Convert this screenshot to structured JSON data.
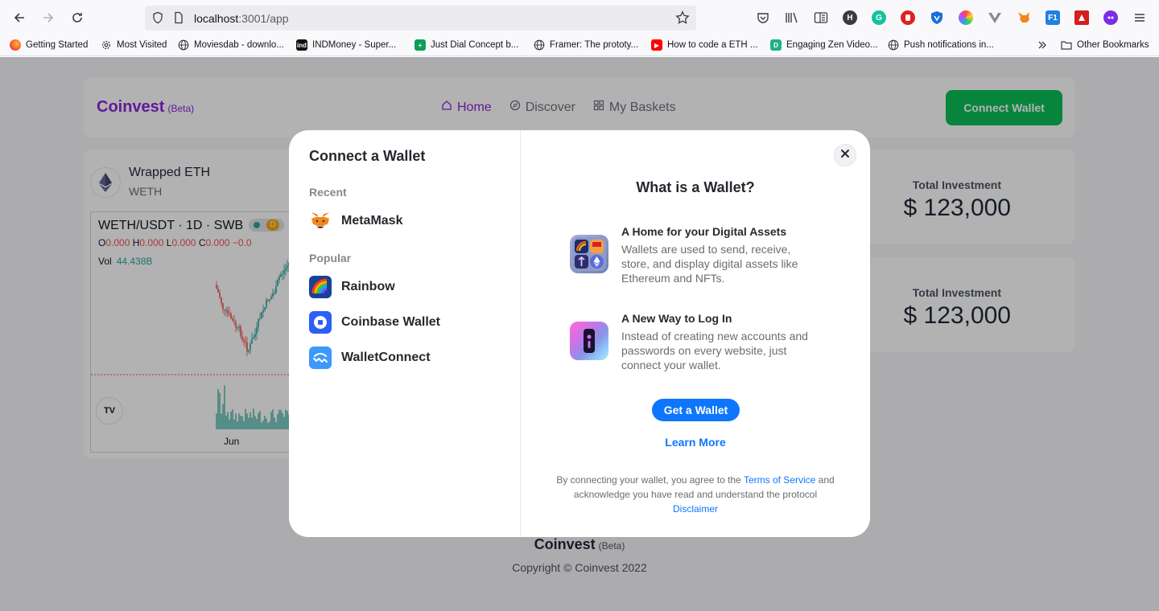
{
  "browser": {
    "url_host": "localhost",
    "url_path": ":3001/app",
    "bookmarks": [
      {
        "label": "Getting Started",
        "icon": "firefox-icon"
      },
      {
        "label": "Most Visited",
        "icon": "gear-icon"
      },
      {
        "label": "Moviesdab - downlo...",
        "icon": "globe-icon"
      },
      {
        "label": "INDMoney - Super...",
        "icon": "indmoney-icon"
      },
      {
        "label": "Just Dial Concept b...",
        "icon": "green-plus-icon"
      },
      {
        "label": "Framer: The prototy...",
        "icon": "globe-icon"
      },
      {
        "label": "How to code a ETH ...",
        "icon": "youtube-icon"
      },
      {
        "label": "Engaging Zen Video...",
        "icon": "zen-icon"
      },
      {
        "label": "Push notifications in...",
        "icon": "globe-icon"
      }
    ],
    "other_bookmarks": "Other Bookmarks",
    "extension_letters": {
      "h": "H",
      "g": "G",
      "f": "F1"
    }
  },
  "header": {
    "brand": "Coinvest",
    "beta": "(Beta)",
    "nav": [
      "Home",
      "Discover",
      "My Baskets"
    ],
    "connect_label": "Connect Wallet"
  },
  "token": {
    "name": "Wrapped ETH",
    "symbol": "WETH",
    "pair": "WETH/USDT · 1D · SWB",
    "ohlc": {
      "o": "0.000",
      "h": "0.000",
      "l": "0.000",
      "c": "0.000",
      "chg": "−0.0"
    },
    "vol_label": "Vol",
    "vol_value": "44.438B",
    "badge_d": "D",
    "month": "Jun",
    "tv_logo": "TV"
  },
  "investments": [
    {
      "label": "Total Investment",
      "value": "$ 123,000"
    },
    {
      "label": "Total Investment",
      "value": "$ 123,000"
    }
  ],
  "footer": {
    "brand": "Coinvest",
    "beta": "(Beta)",
    "copyright": "Copyright © Coinvest 2022"
  },
  "modal": {
    "title": "Connect a Wallet",
    "recent_label": "Recent",
    "recent": [
      {
        "name": "MetaMask",
        "icon": "metamask-icon"
      }
    ],
    "popular_label": "Popular",
    "popular": [
      {
        "name": "Rainbow",
        "icon": "rainbow-icon"
      },
      {
        "name": "Coinbase Wallet",
        "icon": "coinbase-icon"
      },
      {
        "name": "WalletConnect",
        "icon": "walletconnect-icon"
      }
    ],
    "right_title": "What is a Wallet?",
    "info": [
      {
        "title": "A Home for your Digital Assets",
        "lines": [
          "Wallets are used to send, receive,",
          "store, and display digital assets like",
          "Ethereum and NFTs."
        ]
      },
      {
        "title": "A New Way to Log In",
        "lines": [
          "Instead of creating new accounts and",
          "passwords on every website, just",
          "connect your wallet."
        ]
      }
    ],
    "get_wallet": "Get a Wallet",
    "learn_more": "Learn More",
    "legal_prefix": "By connecting your wallet, you agree to the",
    "terms": "Terms of Service",
    "legal_middle": "and acknowledge you have read and understand the protocol",
    "disclaimer": "Disclaimer"
  }
}
